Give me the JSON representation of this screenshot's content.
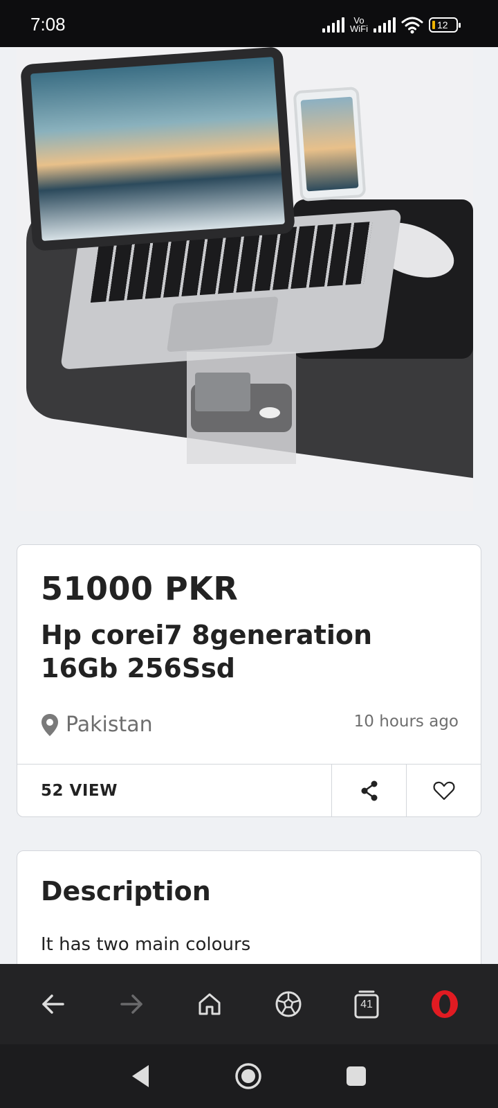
{
  "status_bar": {
    "time": "7:08",
    "vowifi_top": "Vo",
    "vowifi_bottom": "WiFi",
    "battery": "12"
  },
  "listing": {
    "price": "51000 PKR",
    "title": "Hp corei7 8generation 16Gb 256Ssd",
    "location": "Pakistan",
    "posted": "10 hours ago",
    "views": "52 VIEW"
  },
  "description": {
    "heading": "Description",
    "text": "It has two main colours"
  },
  "browser_bar": {
    "tab_count": "41"
  },
  "colors": {
    "opera_red": "#e11b22",
    "status_bar_bg": "#0d0d0f",
    "page_bg": "#eff1f4"
  }
}
